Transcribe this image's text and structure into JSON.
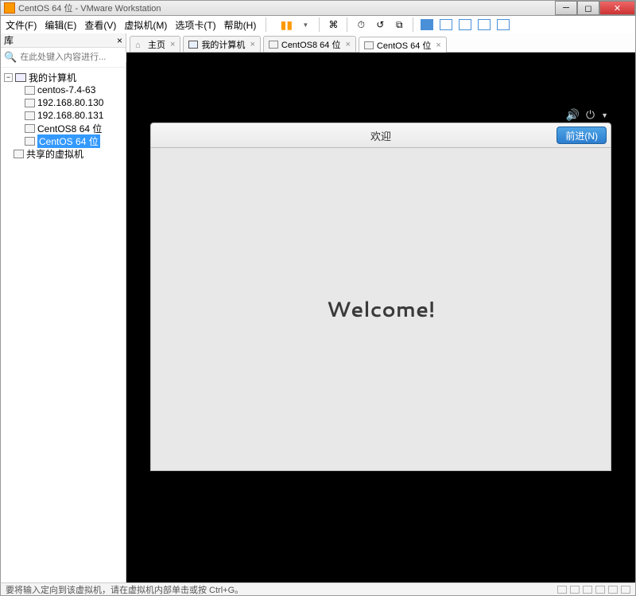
{
  "window": {
    "title": "CentOS 64 位 - VMware Workstation"
  },
  "menu": {
    "file": "文件(F)",
    "edit": "编辑(E)",
    "view": "查看(V)",
    "vm": "虚拟机(M)",
    "tabs": "选项卡(T)",
    "help": "帮助(H)"
  },
  "sidebar": {
    "title": "库",
    "search_placeholder": "在此处键入内容进行...",
    "root": "我的计算机",
    "items": [
      {
        "label": "centos-7.4-63"
      },
      {
        "label": "192.168.80.130"
      },
      {
        "label": "192.168.80.131"
      },
      {
        "label": "CentOS8 64 位"
      },
      {
        "label": "CentOS 64 位"
      }
    ],
    "shared": "共享的虚拟机"
  },
  "tabs": [
    {
      "label": "主页",
      "icon": "home"
    },
    {
      "label": "我的计算机",
      "icon": "mon"
    },
    {
      "label": "CentOS8 64 位",
      "icon": "vm"
    },
    {
      "label": "CentOS 64 位",
      "icon": "vm",
      "active": true
    }
  ],
  "guest": {
    "bar_title": "欢迎",
    "next_button": "前进(N)",
    "body_text": "Welcome!"
  },
  "status": {
    "text": "要将输入定向到该虚拟机，请在虚拟机内部单击或按 Ctrl+G。"
  }
}
